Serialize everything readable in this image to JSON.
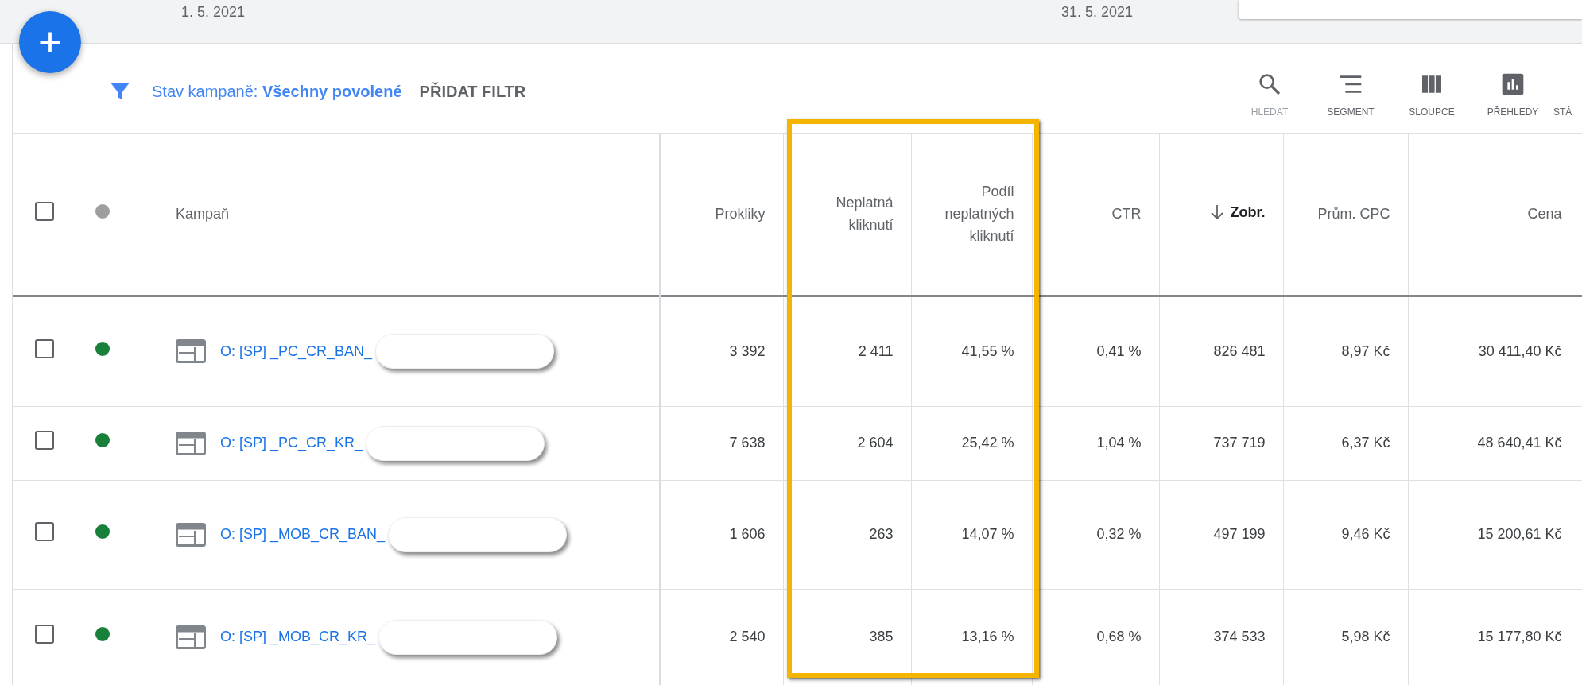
{
  "date_range": {
    "start": "1. 5. 2021",
    "end": "31. 5. 2021"
  },
  "filter": {
    "label": "Stav kampaně:",
    "value": "Všechny povolené",
    "add_button": "PŘIDAT FILTR"
  },
  "toolbar": [
    {
      "kind": "search",
      "label": "HLEDAT"
    },
    {
      "kind": "segment",
      "label": "SEGMENT"
    },
    {
      "kind": "columns",
      "label": "SLOUPCE"
    },
    {
      "kind": "reports",
      "label": "PŘEHLEDY"
    },
    {
      "kind": "other",
      "label": "STÁ"
    }
  ],
  "table": {
    "header_checked": false,
    "columns": [
      {
        "label": "Kampaň",
        "sorted": false
      },
      {
        "label": "Prokliky",
        "sorted": false
      },
      {
        "label": "Neplatná kliknutí",
        "sorted": false
      },
      {
        "label": "Podíl neplatných kliknutí",
        "sorted": false
      },
      {
        "label": "CTR",
        "sorted": false
      },
      {
        "label": "Zobr.",
        "sorted": true
      },
      {
        "label": "Prům. CPC",
        "sorted": false
      },
      {
        "label": "Cena",
        "sorted": false
      }
    ],
    "rows": [
      {
        "checked": false,
        "color": "#188038",
        "campaign": "O: [SP] _PC_CR_BAN_",
        "values": [
          "3 392",
          "2 411",
          "41,55 %",
          "0,41 %",
          "826 481",
          "8,97 Kč",
          "30 411,40 Kč"
        ]
      },
      {
        "checked": false,
        "color": "#188038",
        "campaign": "O: [SP] _PC_CR_KR_",
        "values": [
          "7 638",
          "2 604",
          "25,42 %",
          "1,04 %",
          "737 719",
          "6,37 Kč",
          "48 640,41 Kč"
        ]
      },
      {
        "checked": false,
        "color": "#188038",
        "campaign": "O: [SP] _MOB_CR_BAN_",
        "values": [
          "1 606",
          "263",
          "14,07 %",
          "0,32 %",
          "497 199",
          "9,46 Kč",
          "15 200,61 Kč"
        ]
      },
      {
        "checked": false,
        "color": "#188038",
        "campaign": "O: [SP] _MOB_CR_KR_",
        "values": [
          "2 540",
          "385",
          "13,16 %",
          "0,68 %",
          "374 533",
          "5,98 Kč",
          "15 177,80 Kč"
        ]
      }
    ]
  }
}
